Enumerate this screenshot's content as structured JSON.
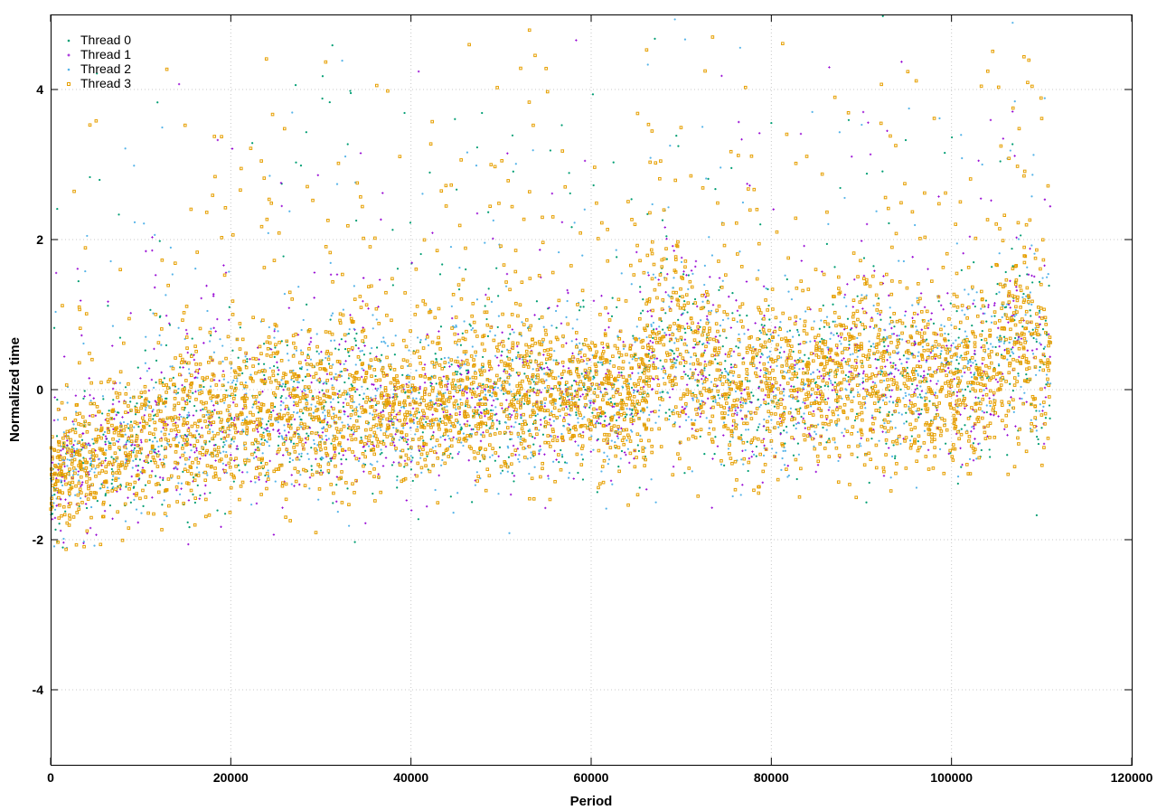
{
  "chart_data": {
    "type": "scatter",
    "title": "",
    "xlabel": "Period",
    "ylabel": "Normalized time",
    "xlim": [
      0,
      120000
    ],
    "ylim": [
      -5,
      5
    ],
    "x_ticks": [
      0,
      20000,
      40000,
      60000,
      80000,
      100000,
      120000
    ],
    "y_ticks": [
      -4,
      -2,
      0,
      2,
      4
    ],
    "x_tick_labels": [
      "0",
      "20000",
      "40000",
      "60000",
      "80000",
      "100000",
      "120000"
    ],
    "y_tick_labels": [
      "-4",
      "-2",
      "0",
      "2",
      "4"
    ],
    "grid": true,
    "legend_position": "top-left",
    "x_data_range": [
      0,
      111000
    ],
    "series": [
      {
        "name": "Thread 0",
        "color": "#009e73",
        "marker": "dot"
      },
      {
        "name": "Thread 1",
        "color": "#9400d3",
        "marker": "plus"
      },
      {
        "name": "Thread 2",
        "color": "#56b4e9",
        "marker": "dot"
      },
      {
        "name": "Thread 3",
        "color": "#e69f00",
        "marker": "square"
      }
    ],
    "trend": [
      {
        "x": 0,
        "y": -1.2,
        "spread": 0.8
      },
      {
        "x": 5000,
        "y": -0.9,
        "spread": 0.85
      },
      {
        "x": 10000,
        "y": -0.7,
        "spread": 0.8
      },
      {
        "x": 15000,
        "y": -0.45,
        "spread": 1.0
      },
      {
        "x": 20000,
        "y": -0.4,
        "spread": 0.9
      },
      {
        "x": 25000,
        "y": -0.35,
        "spread": 0.9
      },
      {
        "x": 30000,
        "y": -0.3,
        "spread": 1.0
      },
      {
        "x": 33000,
        "y": -0.05,
        "spread": 1.2
      },
      {
        "x": 36000,
        "y": -0.3,
        "spread": 0.9
      },
      {
        "x": 40000,
        "y": -0.25,
        "spread": 0.9
      },
      {
        "x": 45000,
        "y": -0.2,
        "spread": 0.95
      },
      {
        "x": 50000,
        "y": -0.05,
        "spread": 1.1
      },
      {
        "x": 55000,
        "y": -0.2,
        "spread": 0.9
      },
      {
        "x": 60000,
        "y": -0.2,
        "spread": 0.9
      },
      {
        "x": 65000,
        "y": -0.1,
        "spread": 0.95
      },
      {
        "x": 68000,
        "y": 0.6,
        "spread": 1.3
      },
      {
        "x": 72000,
        "y": 0.3,
        "spread": 1.3
      },
      {
        "x": 76000,
        "y": -0.1,
        "spread": 1.0
      },
      {
        "x": 80000,
        "y": -0.1,
        "spread": 1.0
      },
      {
        "x": 85000,
        "y": 0.0,
        "spread": 1.0
      },
      {
        "x": 90000,
        "y": 0.3,
        "spread": 1.2
      },
      {
        "x": 95000,
        "y": 0.1,
        "spread": 1.0
      },
      {
        "x": 100000,
        "y": 0.1,
        "spread": 1.05
      },
      {
        "x": 105000,
        "y": 0.15,
        "spread": 1.05
      },
      {
        "x": 108000,
        "y": 0.8,
        "spread": 1.4
      },
      {
        "x": 111000,
        "y": 0.2,
        "spread": 1.1
      }
    ],
    "lower_bound": -2.0,
    "upper_bound": 5.0
  }
}
